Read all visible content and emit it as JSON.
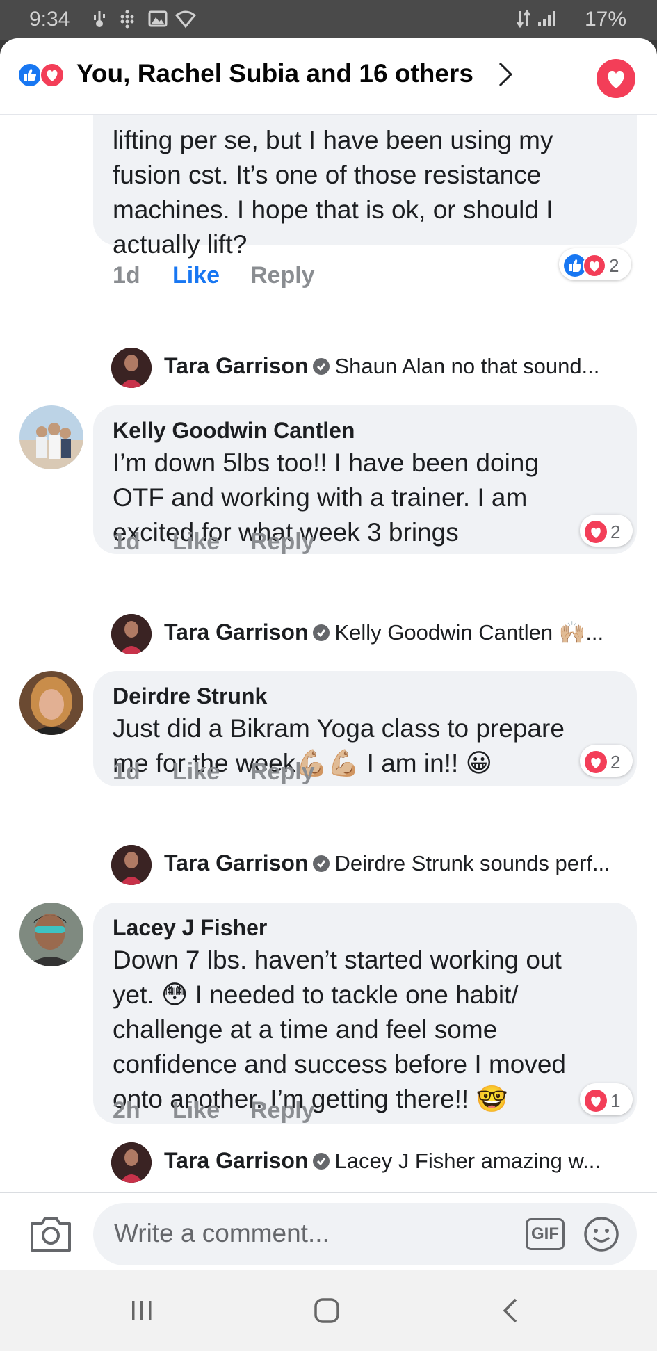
{
  "status_bar": {
    "time": "9:34",
    "battery": "17%",
    "icons": [
      "usb-icon",
      "grid-dots-icon",
      "image-icon",
      "wifi-icon",
      "data-transfer-icon",
      "signal-icon",
      "battery-icon"
    ]
  },
  "header": {
    "reactions": [
      "like-icon",
      "love-icon"
    ],
    "title": "You, Rachel Subia and 16 others",
    "chevron": "chevron-right-icon",
    "heart": "heart-icon"
  },
  "comments": [
    {
      "author": "",
      "text_lines": [
        "lifting per se, but I have been using my",
        "fusion cst.  It’s one of those resistance",
        "machines.  I hope that is ok, or should I",
        "actually lift?"
      ],
      "time": "1d",
      "like_label": "Like",
      "liked": true,
      "reply_label": "Reply",
      "reactions": [
        "like-icon",
        "love-icon"
      ],
      "reaction_count": "2",
      "reply": {
        "author": "Tara Garrison",
        "preview": "Shaun Alan no that sound..."
      }
    },
    {
      "author": "Kelly Goodwin Cantlen",
      "text_lines": [
        "I’m down 5lbs too!!  I have been doing",
        "OTF and working with a trainer. I am",
        "excited for what week 3 brings"
      ],
      "time": "1d",
      "like_label": "Like",
      "liked": false,
      "reply_label": "Reply",
      "reactions": [
        "love-icon"
      ],
      "reaction_count": "2",
      "reply": {
        "author": "Tara Garrison",
        "preview": "Kelly Goodwin Cantlen 🙌🏼..."
      }
    },
    {
      "author": "Deirdre Strunk",
      "text_lines": [
        "Just did a Bikram Yoga class to prepare",
        "me for the week💪🏼💪🏼 I am in!! 😀"
      ],
      "time": "1d",
      "like_label": "Like",
      "liked": false,
      "reply_label": "Reply",
      "reactions": [
        "love-icon"
      ],
      "reaction_count": "2",
      "reply": {
        "author": "Tara Garrison",
        "preview": "Deirdre Strunk sounds perf..."
      }
    },
    {
      "author": "Lacey J Fisher",
      "text_lines": [
        "Down 7 lbs. haven’t started working out",
        "yet. 😳 I needed to tackle one habit/",
        "challenge at a time and feel some",
        "confidence and success before I moved",
        "onto another. I’m getting there!! 🤓"
      ],
      "time": "2h",
      "like_label": "Like",
      "liked": false,
      "reply_label": "Reply",
      "reactions": [
        "love-icon"
      ],
      "reaction_count": "1",
      "reply": {
        "author": "Tara Garrison",
        "preview": "Lacey J Fisher amazing w..."
      }
    }
  ],
  "composer": {
    "placeholder": "Write a comment...",
    "gif_label": "GIF",
    "camera": "camera-icon",
    "emoji": "smiley-icon"
  },
  "nav": [
    "recent-apps-icon",
    "home-icon",
    "back-icon"
  ],
  "colors": {
    "facebook_blue": "#1877f2",
    "love_red": "#f33e58",
    "bubble_gray": "#f0f2f5",
    "secondary_text": "#8a8d91"
  }
}
